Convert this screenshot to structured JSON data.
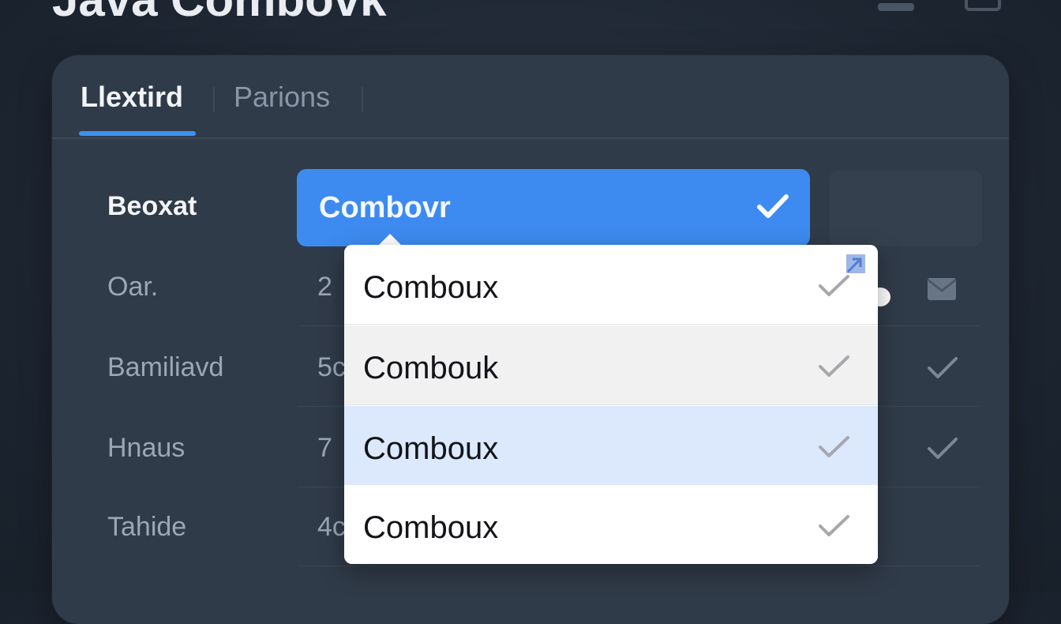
{
  "window": {
    "title": "Java Combovk"
  },
  "tabs": [
    {
      "label": "Llextird",
      "active": true
    },
    {
      "label": "Parions",
      "active": false
    }
  ],
  "rows": [
    {
      "label": "Beoxat"
    },
    {
      "label": "Oar.",
      "value": "2"
    },
    {
      "label": "Bamiliavd",
      "value": "5c"
    },
    {
      "label": "Hnaus",
      "value": "7"
    },
    {
      "label": "Tahide",
      "value": "4c"
    }
  ],
  "combo": {
    "selected": "Combovr"
  },
  "dropdown": {
    "options": [
      {
        "label": "Comboux"
      },
      {
        "label": "Combouk"
      },
      {
        "label": "Comboux",
        "highlighted": true
      },
      {
        "label": "Comboux"
      }
    ]
  },
  "colors": {
    "accent": "#3d8bf0",
    "panel": "#303b49",
    "background": "#1c2430",
    "highlight_row": "#dce8fc",
    "hover_row": "#f1f1f2"
  },
  "icons": {
    "top_left": "user-icon",
    "top_right": "window-icon",
    "combo_check": "check-icon",
    "dropdown_check": "check-icon",
    "expand": "expand-icon",
    "mail": "mail-icon"
  }
}
